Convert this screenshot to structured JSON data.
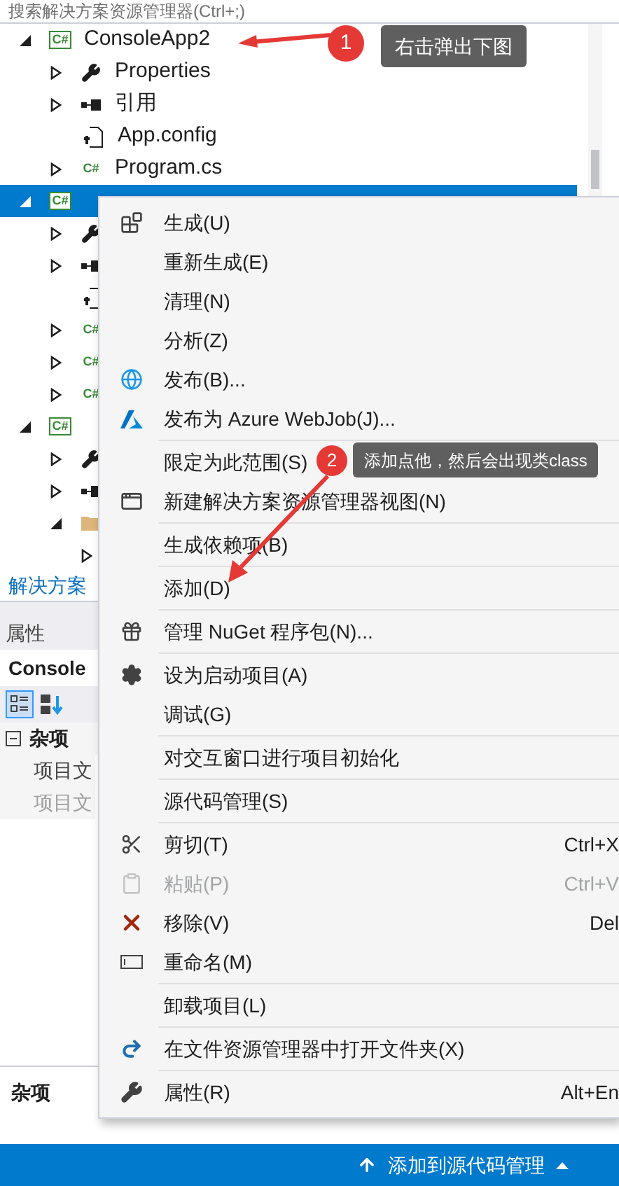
{
  "search": {
    "placeholder": "搜索解决方案资源管理器(Ctrl+;)"
  },
  "tree": [
    {
      "label": "ConsoleApp2",
      "kind": "project",
      "icon": "C#",
      "expanded": true,
      "selected": false,
      "children": [
        {
          "label": "Properties",
          "kind": "properties",
          "expanded": false,
          "selected": false
        },
        {
          "label": "引用",
          "kind": "references",
          "expanded": false,
          "selected": false
        },
        {
          "label": "App.config",
          "kind": "config",
          "selected": false
        },
        {
          "label": "Program.cs",
          "kind": "cs",
          "icon": "C#",
          "expanded": false,
          "selected": false
        }
      ]
    },
    {
      "kind": "project",
      "icon": "C#",
      "expanded": true,
      "selected": true,
      "children": [
        {
          "kind": "properties",
          "expanded": false,
          "selected": false
        },
        {
          "kind": "references",
          "expanded": false,
          "selected": false
        },
        {
          "kind": "config",
          "selected": false
        },
        {
          "kind": "cs",
          "icon": "C#",
          "expanded": false,
          "selected": false
        },
        {
          "kind": "cs",
          "icon": "C#",
          "expanded": false,
          "selected": false
        },
        {
          "kind": "cs",
          "icon": "C#",
          "expanded": false,
          "selected": false
        }
      ]
    },
    {
      "kind": "project",
      "icon": "C#",
      "expanded": true,
      "selected": false,
      "children": [
        {
          "kind": "properties",
          "expanded": false,
          "selected": false
        },
        {
          "kind": "references",
          "expanded": false,
          "selected": false
        },
        {
          "kind": "folder",
          "expanded": true,
          "selected": false,
          "children": [
            {
              "expanded": false,
              "selected": false
            }
          ]
        }
      ]
    }
  ],
  "explorer_tab": "解决方案",
  "properties": {
    "title": "属性",
    "object": "Console",
    "category": "杂项",
    "rows": [
      {
        "label": "项目文",
        "disabled": false
      },
      {
        "label": "项目文",
        "disabled": true
      }
    ],
    "description_title": "杂项"
  },
  "menu": {
    "items": [
      {
        "label": "生成(U)",
        "disabled": false,
        "separator_after": false
      },
      {
        "label": "重新生成(E)",
        "disabled": false,
        "separator_after": false
      },
      {
        "label": "清理(N)",
        "disabled": false,
        "separator_after": false
      },
      {
        "label": "分析(Z)",
        "disabled": false,
        "separator_after": false
      },
      {
        "label": "发布(B)...",
        "disabled": false,
        "separator_after": false
      },
      {
        "label": "发布为 Azure WebJob(J)...",
        "disabled": false,
        "separator_after": true
      },
      {
        "label": "限定为此范围(S)",
        "disabled": false,
        "separator_after": false
      },
      {
        "label": "新建解决方案资源管理器视图(N)",
        "disabled": false,
        "separator_after": true
      },
      {
        "label": "生成依赖项(B)",
        "disabled": false,
        "separator_after": true
      },
      {
        "label": "添加(D)",
        "disabled": false,
        "separator_after": true
      },
      {
        "label": "管理 NuGet 程序包(N)...",
        "disabled": false,
        "separator_after": true
      },
      {
        "label": "设为启动项目(A)",
        "disabled": false,
        "separator_after": false
      },
      {
        "label": "调试(G)",
        "disabled": false,
        "separator_after": true
      },
      {
        "label": "对交互窗口进行项目初始化",
        "disabled": false,
        "separator_after": true
      },
      {
        "label": "源代码管理(S)",
        "disabled": false,
        "separator_after": true
      },
      {
        "label": "剪切(T)",
        "shortcut": "Ctrl+X",
        "disabled": false,
        "separator_after": false
      },
      {
        "label": "粘贴(P)",
        "shortcut": "Ctrl+V",
        "disabled": true,
        "separator_after": false
      },
      {
        "label": "移除(V)",
        "shortcut": "Del",
        "disabled": false,
        "separator_after": false
      },
      {
        "label": "重命名(M)",
        "disabled": false,
        "separator_after": true
      },
      {
        "label": "卸载项目(L)",
        "disabled": false,
        "separator_after": true
      },
      {
        "label": "在文件资源管理器中打开文件夹(X)",
        "disabled": false,
        "separator_after": true
      },
      {
        "label": "属性(R)",
        "shortcut": "Alt+En",
        "disabled": false,
        "separator_after": false
      }
    ]
  },
  "annotations": [
    {
      "number": "1",
      "text": "右击弹出下图"
    },
    {
      "number": "2",
      "text": "添加点他，然后会出现类class"
    }
  ],
  "status_bar": {
    "text": "添加到源代码管理"
  }
}
